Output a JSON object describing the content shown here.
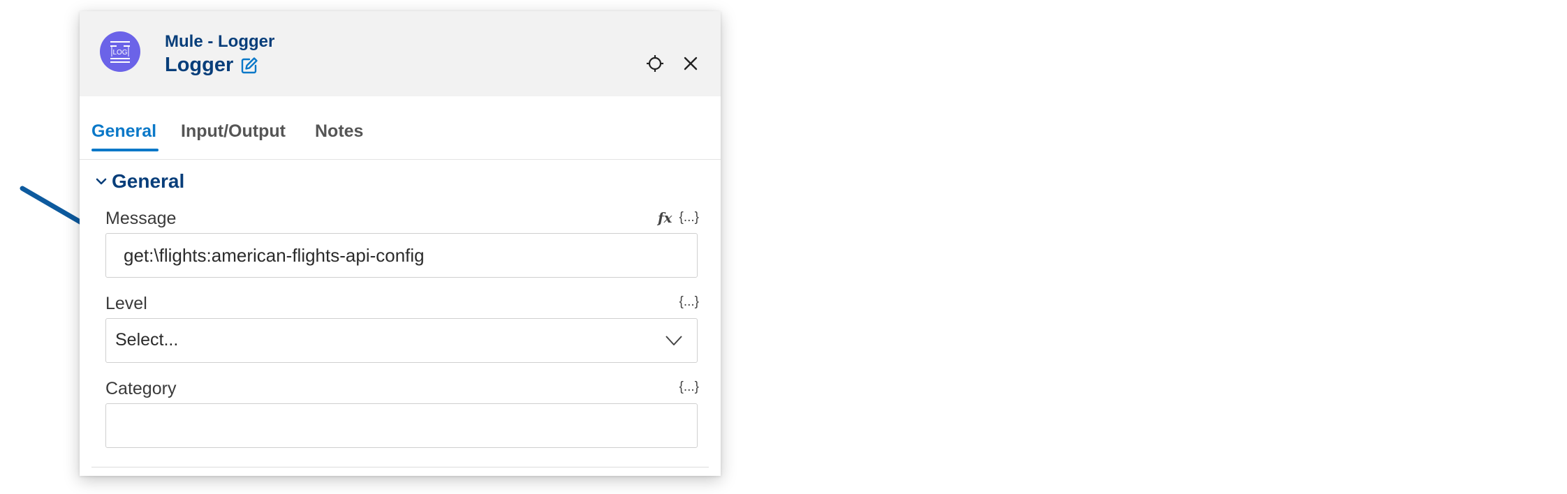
{
  "header": {
    "subtitle": "Mule - Logger",
    "title": "Logger",
    "avatar_icon": "log-icon",
    "avatar_color": "#6b63e8"
  },
  "tabs": [
    {
      "label": "General",
      "active": true
    },
    {
      "label": "Input/Output",
      "active": false
    },
    {
      "label": "Notes",
      "active": false
    }
  ],
  "section": {
    "title": "General",
    "expanded": true
  },
  "fields": {
    "message": {
      "label": "Message",
      "value": "get:\\flights:american-flights-api-config",
      "fx_label": "fx",
      "braces_label": "{...}"
    },
    "level": {
      "label": "Level",
      "value": "Select...",
      "braces_label": "{...}"
    },
    "category": {
      "label": "Category",
      "value": "",
      "braces_label": "{...}"
    }
  },
  "colors": {
    "accent": "#0a78c8",
    "heading": "#083e7a",
    "annotation_arrow": "#0d5a9e"
  }
}
